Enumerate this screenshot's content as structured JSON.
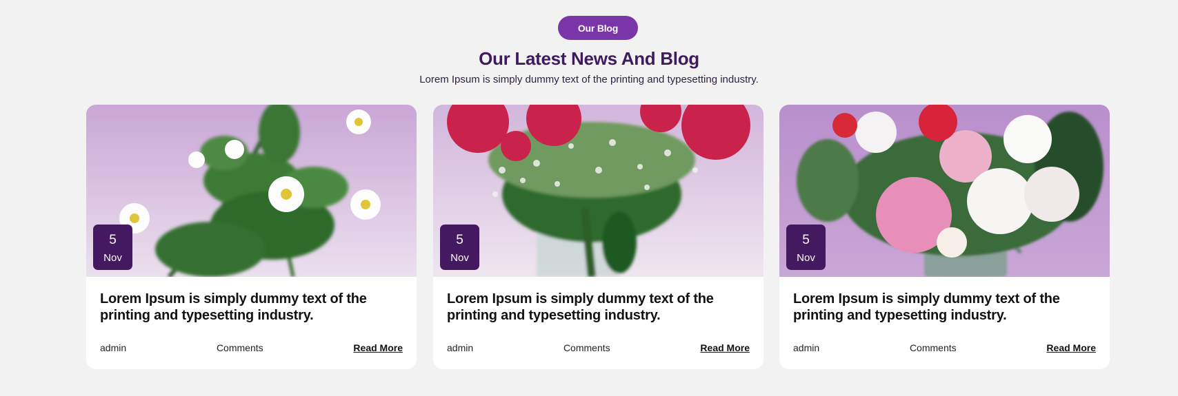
{
  "section": {
    "badge_label": "Our Blog",
    "title": "Our Latest News And Blog",
    "subtitle": "Lorem Ipsum is simply dummy text of the printing and typesetting industry."
  },
  "colors": {
    "accent": "#7a35a8",
    "heading": "#3e1a5e",
    "date_badge": "#45195f",
    "background": "#f3f2f3",
    "card": "#ffffff"
  },
  "posts": [
    {
      "image": "white-anemone-flowers-photo",
      "date_day": "5",
      "date_month": "Nov",
      "title": "Lorem Ipsum is simply dummy text of the printing and typesetting industry.",
      "author": "admin",
      "comments": "Comments",
      "read_more": "Read More"
    },
    {
      "image": "red-roses-vase-photo",
      "date_day": "5",
      "date_month": "Nov",
      "title": "Lorem Ipsum is simply dummy text of the printing and typesetting industry.",
      "author": "admin",
      "comments": "Comments",
      "read_more": "Read More"
    },
    {
      "image": "peony-bouquet-photo",
      "date_day": "5",
      "date_month": "Nov",
      "title": "Lorem Ipsum is simply dummy text of the printing and typesetting industry.",
      "author": "admin",
      "comments": "Comments",
      "read_more": "Read More"
    }
  ]
}
